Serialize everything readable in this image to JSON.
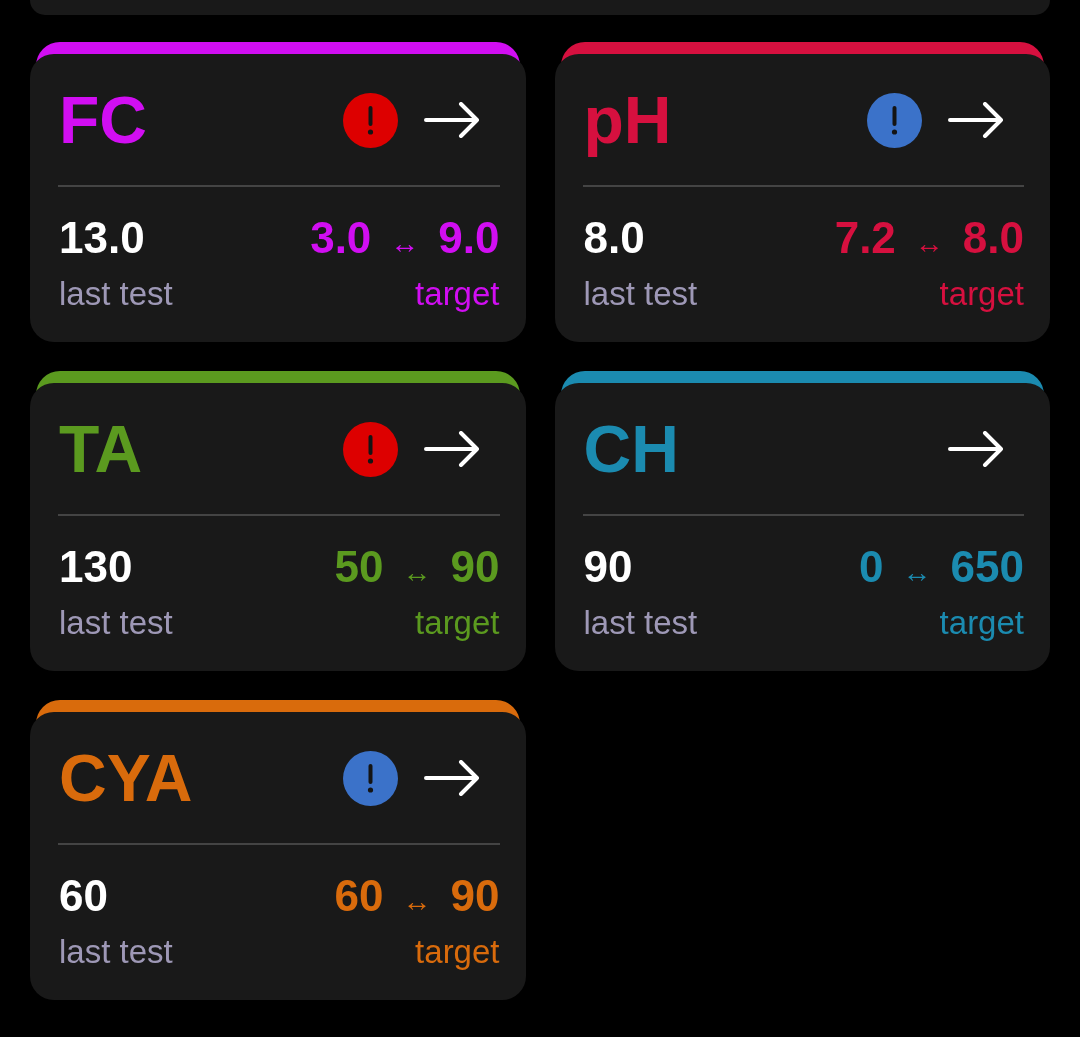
{
  "cards": [
    {
      "title": "FC",
      "color": "#d10ef2",
      "alert": {
        "color": "#dd0000"
      },
      "reading": {
        "value": "13.0",
        "label": "last test"
      },
      "target": {
        "min": "3.0",
        "separator": "↔",
        "max": "9.0",
        "label": "target"
      }
    },
    {
      "title": "pH",
      "color": "#d6103f",
      "alert": {
        "color": "#3b72c9"
      },
      "reading": {
        "value": "8.0",
        "label": "last test"
      },
      "target": {
        "min": "7.2",
        "separator": "↔",
        "max": "8.0",
        "label": "target"
      }
    },
    {
      "title": "TA",
      "color": "#5b9a1f",
      "alert": {
        "color": "#dd0000"
      },
      "reading": {
        "value": "130",
        "label": "last test"
      },
      "target": {
        "min": "50",
        "separator": "↔",
        "max": "90",
        "label": "target"
      }
    },
    {
      "title": "CH",
      "color": "#1b8bb0",
      "reading": {
        "value": "90",
        "label": "last test"
      },
      "target": {
        "min": "0",
        "separator": "↔",
        "max": "650",
        "label": "target"
      }
    },
    {
      "title": "CYA",
      "color": "#d96b0c",
      "alert": {
        "color": "#3b72c9"
      },
      "reading": {
        "value": "60",
        "label": "last test"
      },
      "target": {
        "min": "60",
        "separator": "↔",
        "max": "90",
        "label": "target"
      }
    }
  ]
}
